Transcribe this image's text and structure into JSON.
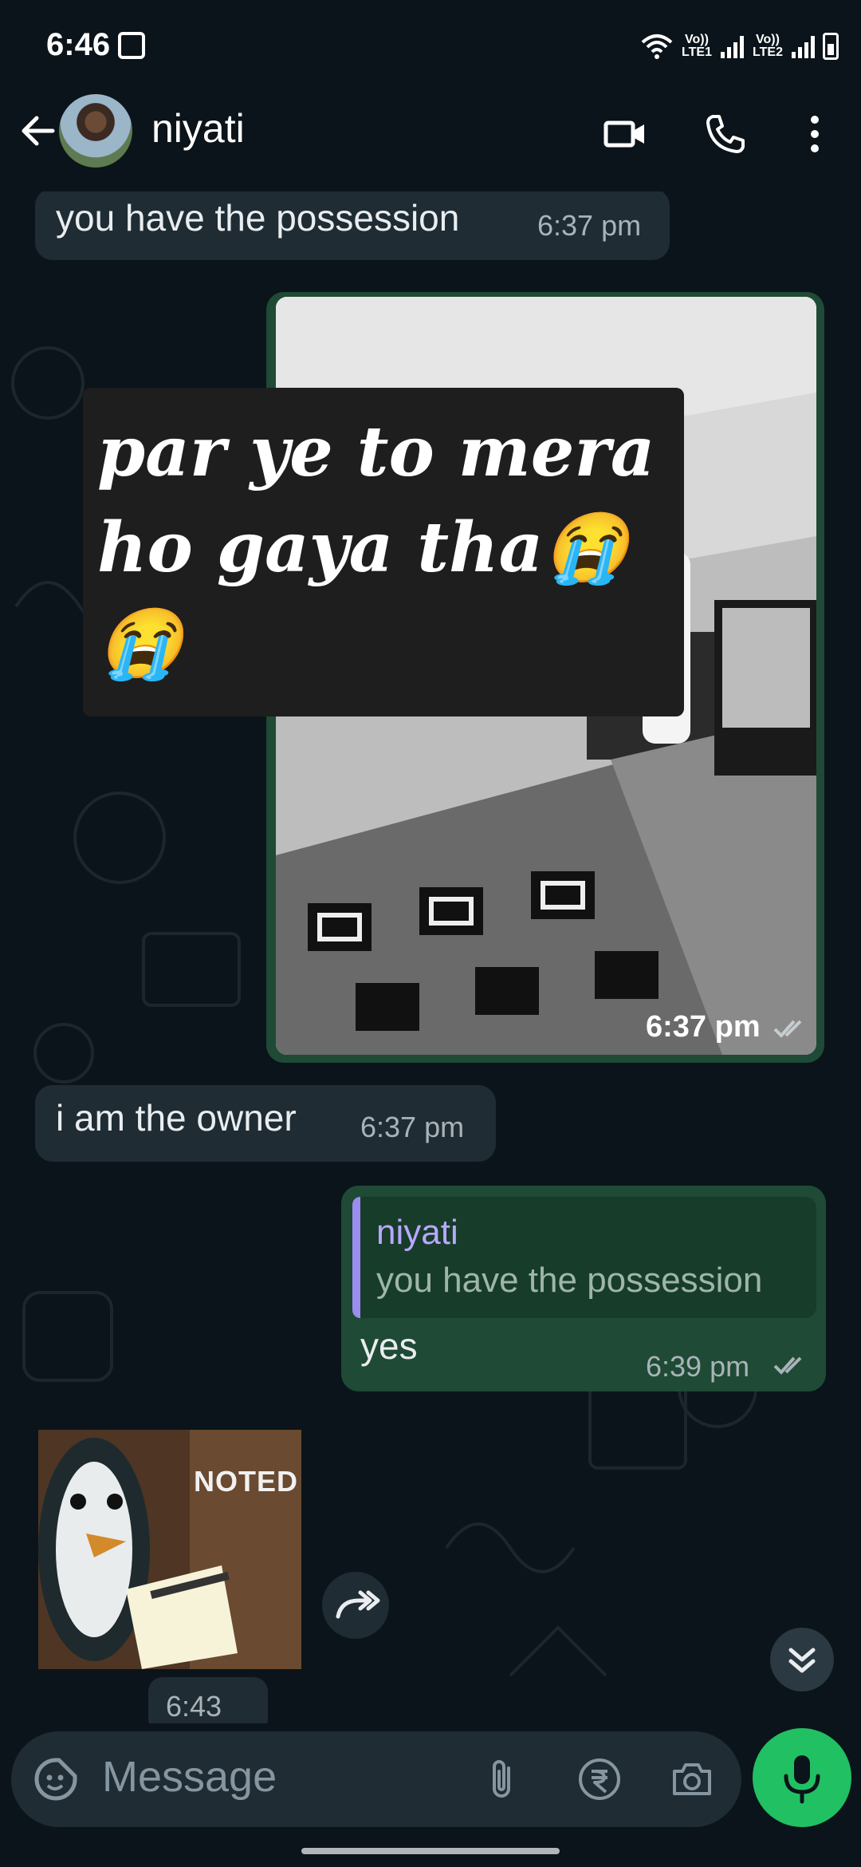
{
  "status_bar": {
    "time": "6:46",
    "sim1": "Vo)) LTE1",
    "sim2": "Vo)) LTE2"
  },
  "header": {
    "contact_name": "niyati",
    "icons": [
      "back-arrow-icon",
      "video-call-icon",
      "voice-call-icon",
      "more-options-icon"
    ]
  },
  "messages": [
    {
      "direction": "incoming",
      "text": "you have the possession",
      "time": "6:37 pm"
    },
    {
      "direction": "outgoing",
      "type": "image",
      "overlay_line1": "par ye to mera",
      "overlay_line2": "ho gaya tha😭",
      "overlay_line3": "😭",
      "time": "6:37 pm",
      "status": "read"
    },
    {
      "direction": "incoming",
      "text": "i am the owner",
      "time": "6:37 pm"
    },
    {
      "direction": "outgoing",
      "reply_to_name": "niyati",
      "reply_to_text": "you have the possession",
      "text": "yes",
      "time": "6:39 pm",
      "status": "read"
    },
    {
      "direction": "incoming",
      "type": "sticker",
      "sticker_text": "NOTED",
      "time": "6:43 pm"
    }
  ],
  "composer": {
    "placeholder": "Message",
    "icons": [
      "emoji-sticker-icon",
      "attach-icon",
      "rupee-payment-icon",
      "camera-icon",
      "mic-icon"
    ]
  },
  "colors": {
    "background": "#0b141a",
    "incoming_bubble": "#1f2c34",
    "outgoing_bubble": "#1f4a35",
    "accent_green": "#21c063",
    "reply_accent": "#9c8cf0",
    "read_tick": "#a9b3b8"
  }
}
